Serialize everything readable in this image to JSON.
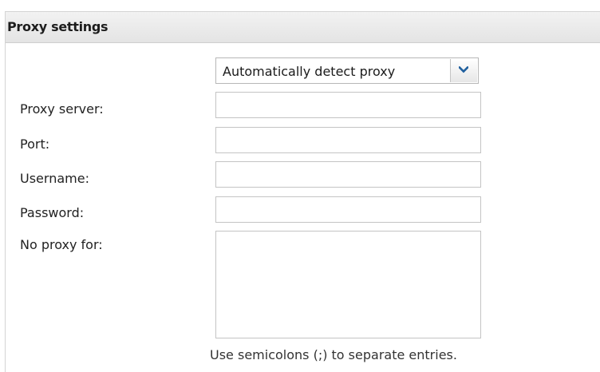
{
  "panel": {
    "title": "Proxy settings"
  },
  "proxy_mode": {
    "selected": "Automatically detect proxy"
  },
  "fields": {
    "proxy_server": {
      "label": "Proxy server:",
      "value": ""
    },
    "port": {
      "label": "Port:",
      "value": ""
    },
    "username": {
      "label": "Username:",
      "value": ""
    },
    "password": {
      "label": "Password:",
      "value": ""
    },
    "no_proxy_for": {
      "label": "No proxy for:",
      "value": ""
    }
  },
  "hint": "Use semicolons (;) to separate entries.",
  "icons": {
    "dropdown": "chevron-down-icon"
  },
  "colors": {
    "header_bg": "#e9e9e9",
    "border": "#c4c4c4",
    "chevron": "#1f5f9e"
  }
}
